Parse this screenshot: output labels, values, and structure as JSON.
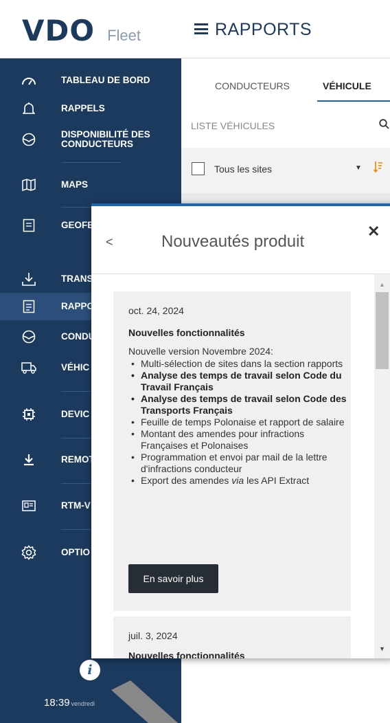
{
  "header": {
    "logo_text": "VDO",
    "logo_sub": "Fleet",
    "page_title": "RAPPORTS"
  },
  "sidebar": {
    "items": [
      {
        "label": "TABLEAU DE BORD",
        "icon": "speedometer-icon"
      },
      {
        "label": "RAPPELS",
        "icon": "bell-icon"
      },
      {
        "label": "DISPONIBILITÉ DES CONDUCTEURS",
        "icon": "steering-wheel-icon"
      },
      {
        "label": "MAPS",
        "icon": "map-icon"
      },
      {
        "label": "GEOFE",
        "icon": "document-icon"
      },
      {
        "label": "TRANS",
        "icon": "download-tray-icon"
      },
      {
        "label": "RAPPO",
        "icon": "report-icon",
        "active": true
      },
      {
        "label": "CONDU",
        "icon": "steering-wheel-icon"
      },
      {
        "label": "VÉHIC",
        "icon": "truck-icon"
      },
      {
        "label": "DEVIC",
        "icon": "chip-icon"
      },
      {
        "label": "REMOT",
        "icon": "download-icon"
      },
      {
        "label": "RTM-V",
        "icon": "card-reader-icon"
      },
      {
        "label": "OPTIO",
        "icon": "gear-icon"
      }
    ],
    "info_label": "i",
    "time": "18:39",
    "day": "vendredi"
  },
  "content": {
    "tabs": [
      "CONDUCTEURS",
      "VÉHICULE"
    ],
    "active_tab": "VÉHICULE",
    "list_title": "LISTE VÉHICULES",
    "filter_label": "Tous les sites"
  },
  "modal": {
    "title": "Nouveautés produit",
    "back": "<",
    "close": "✕",
    "entries": [
      {
        "date": "oct. 24, 2024",
        "heading": "Nouvelles fonctionnalités",
        "intro": "Nouvelle version Novembre 2024:",
        "items": [
          {
            "text": "Multi-sélection de sites dans la section rapports",
            "bold": false
          },
          {
            "text": "Analyse des temps de travail selon Code du Travail Français",
            "bold": true
          },
          {
            "text": "Analyse des temps de travail selon Code des Transports Français",
            "bold": true
          },
          {
            "text": "Feuille de temps Polonaise et rapport de salaire",
            "bold": false
          },
          {
            "text": "Montant des amendes pour infractions Françaises et Polonaises",
            "bold": false
          },
          {
            "text": "Programmation et envoi par mail de la lettre d'infractions conducteur",
            "bold": false
          },
          {
            "text": "Export des amendes via les API Extract",
            "bold": false
          }
        ],
        "button": "En savoir plus"
      },
      {
        "date": "juil. 3, 2024",
        "heading": "Nouvelles fonctionnalités"
      }
    ]
  },
  "colors": {
    "navy": "#1c3a5e",
    "accent_blue": "#1f64a8",
    "sort_orange": "#e89412"
  }
}
